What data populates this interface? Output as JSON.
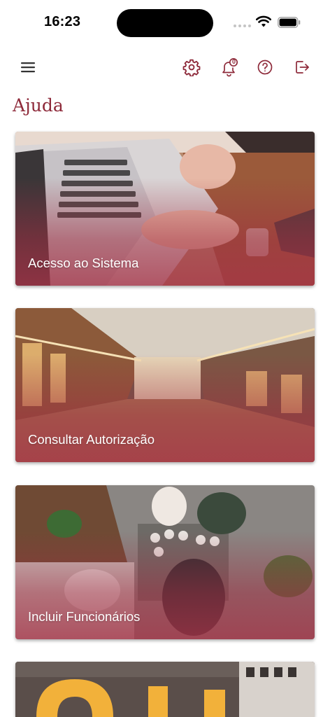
{
  "status_bar": {
    "time": "16:23"
  },
  "toolbar": {
    "notification_count": "0"
  },
  "page": {
    "title": "Ajuda"
  },
  "cards": [
    {
      "label": "Acesso ao Sistema"
    },
    {
      "label": "Consultar Autorização"
    },
    {
      "label": "Incluir Funcionários"
    },
    {
      "label": ""
    }
  ],
  "colors": {
    "brand": "#8e2a3a",
    "overlay": "#a5324a"
  },
  "icons": [
    "menu-icon",
    "gear-icon",
    "bell-icon",
    "help-icon",
    "logout-icon"
  ]
}
